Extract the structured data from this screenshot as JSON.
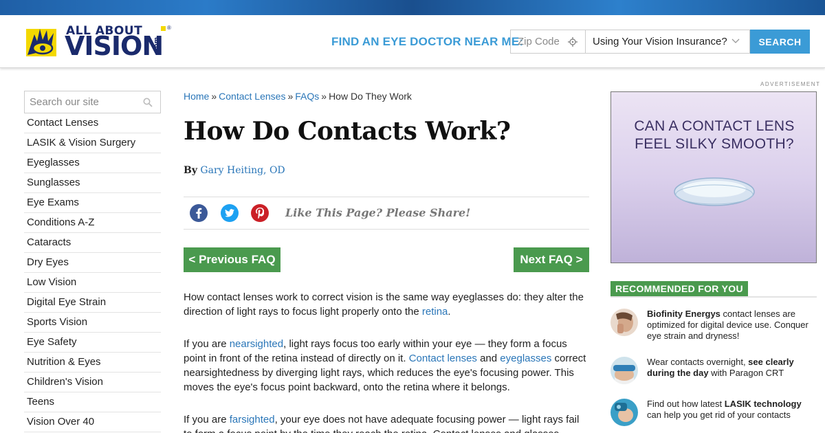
{
  "header": {
    "logo_text_top": "ALL ABOUT",
    "logo_text_main": "VISION",
    "logo_text_com": ".com",
    "find_label": "FIND AN EYE DOCTOR NEAR ME:",
    "zip_placeholder": "Zip Code",
    "insurance_label": "Using Your Vision Insurance?",
    "search_button": "SEARCH"
  },
  "sidebar": {
    "search_placeholder": "Search our site",
    "items": [
      {
        "label": "Contact Lenses"
      },
      {
        "label": "LASIK & Vision Surgery"
      },
      {
        "label": "Eyeglasses"
      },
      {
        "label": "Sunglasses"
      },
      {
        "label": "Eye Exams"
      },
      {
        "label": "Conditions A-Z"
      },
      {
        "label": "Cataracts"
      },
      {
        "label": "Dry Eyes"
      },
      {
        "label": "Low Vision"
      },
      {
        "label": "Digital Eye Strain"
      },
      {
        "label": "Sports Vision"
      },
      {
        "label": "Eye Safety"
      },
      {
        "label": "Nutrition & Eyes"
      },
      {
        "label": "Children's Vision"
      },
      {
        "label": "Teens"
      },
      {
        "label": "Vision Over 40"
      }
    ]
  },
  "breadcrumb": {
    "items": [
      "Home",
      "Contact Lenses",
      "FAQs"
    ],
    "separator": "»",
    "current": "How Do They Work"
  },
  "article": {
    "title": "How Do Contacts Work?",
    "by_label": "By",
    "author": "Gary Heiting, OD",
    "share_text": "Like This Page? Please Share!",
    "prev_label": "< Previous FAQ",
    "next_label": "Next FAQ >",
    "p1": {
      "t1": "How contact lenses work to correct vision is the same way eyeglasses do: they alter the direction of light rays to focus light properly onto the ",
      "link1": "retina",
      "t2": "."
    },
    "p2": {
      "t1": "If you are ",
      "link1": "nearsighted",
      "t2": ", light rays focus too early within your eye — they form a focus point in front of the retina instead of directly on it. ",
      "link2": "Contact lenses",
      "t3": " and ",
      "link3": "eyeglasses",
      "t4": " correct nearsightedness by diverging light rays, which reduces the eye's focusing power. This moves the eye's focus point backward, onto the retina where it belongs."
    },
    "p3": {
      "t1": "If you are ",
      "link1": "farsighted",
      "t2": ", your eye does not have adequate focusing power — light rays fail to form a focus point by the time they reach the retina. Contact lenses and glasses"
    }
  },
  "ad": {
    "label": "ADVERTISEMENT",
    "line1": "CAN A CONTACT LENS",
    "line2": "FEEL SILKY SMOOTH?"
  },
  "recommended": {
    "title": "RECOMMENDED FOR YOU",
    "items": [
      {
        "bold": "Biofinity Energys",
        "text": " contact lenses are optimized for digital device use. Conquer eye strain and dryness!"
      },
      {
        "pre": "Wear contacts overnight, ",
        "bold": "see clearly during the day",
        "post": " with Paragon CRT"
      },
      {
        "pre": "Find out how latest ",
        "bold": "LASIK technology",
        "post": " can help you get rid of your contacts"
      }
    ]
  },
  "colors": {
    "accent_blue": "#3b9bd6",
    "link_blue": "#2a76b8",
    "button_green": "#4a9a4e",
    "logo_navy": "#1a2a6c",
    "logo_yellow": "#f3d800"
  }
}
